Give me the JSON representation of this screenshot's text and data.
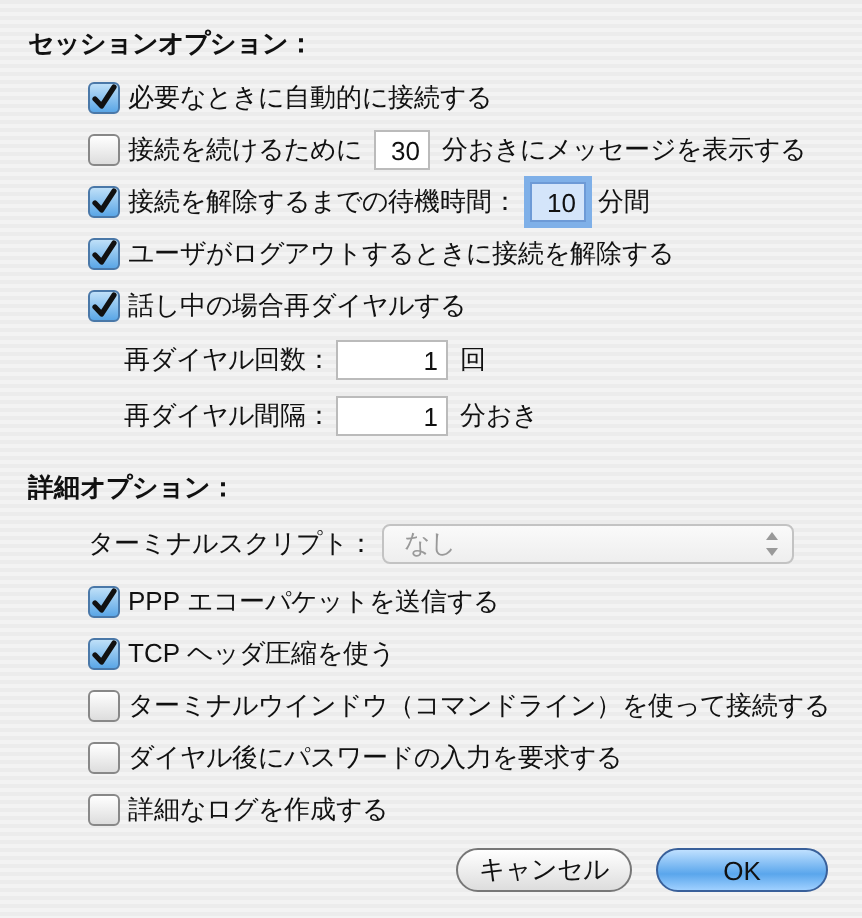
{
  "session_options": {
    "title": "セッションオプション：",
    "rows": [
      {
        "kind": "checkbox",
        "checked": true,
        "label": "必要なときに自動的に接続する"
      },
      {
        "kind": "checkbox",
        "checked": false,
        "label": "接続を続けるために",
        "field": {
          "value": "30",
          "focused": false
        },
        "suffix": "分おきにメッセージを表示する"
      },
      {
        "kind": "checkbox",
        "checked": true,
        "label": "接続を解除するまでの待機時間：",
        "field": {
          "value": "10",
          "focused": true
        },
        "suffix": "分間"
      },
      {
        "kind": "checkbox",
        "checked": true,
        "label": "ユーザがログアウトするときに接続を解除する"
      },
      {
        "kind": "checkbox",
        "checked": true,
        "label": "話し中の場合再ダイヤルする"
      },
      {
        "kind": "number",
        "label": "再ダイヤル回数：",
        "field": {
          "value": "1",
          "focused": false
        },
        "suffix": "回"
      },
      {
        "kind": "number",
        "label": "再ダイヤル間隔：",
        "field": {
          "value": "1",
          "focused": false
        },
        "suffix": "分おき"
      }
    ]
  },
  "advanced_options": {
    "title": "詳細オプション：",
    "rows": [
      {
        "kind": "popup",
        "label": "ターミナルスクリプト：",
        "value": "なし",
        "disabled": true
      },
      {
        "kind": "checkbox",
        "checked": true,
        "label": "PPP エコーパケットを送信する"
      },
      {
        "kind": "checkbox",
        "checked": true,
        "label": "TCP ヘッダ圧縮を使う"
      },
      {
        "kind": "checkbox",
        "checked": false,
        "label": "ターミナルウインドウ（コマンドライン）を使って接続する"
      },
      {
        "kind": "checkbox",
        "checked": false,
        "label": "ダイヤル後にパスワードの入力を要求する"
      },
      {
        "kind": "checkbox",
        "checked": false,
        "label": "詳細なログを作成する"
      }
    ]
  },
  "buttons": [
    {
      "label": "キャンセル",
      "default": false
    },
    {
      "label": "OK",
      "default": true
    }
  ]
}
